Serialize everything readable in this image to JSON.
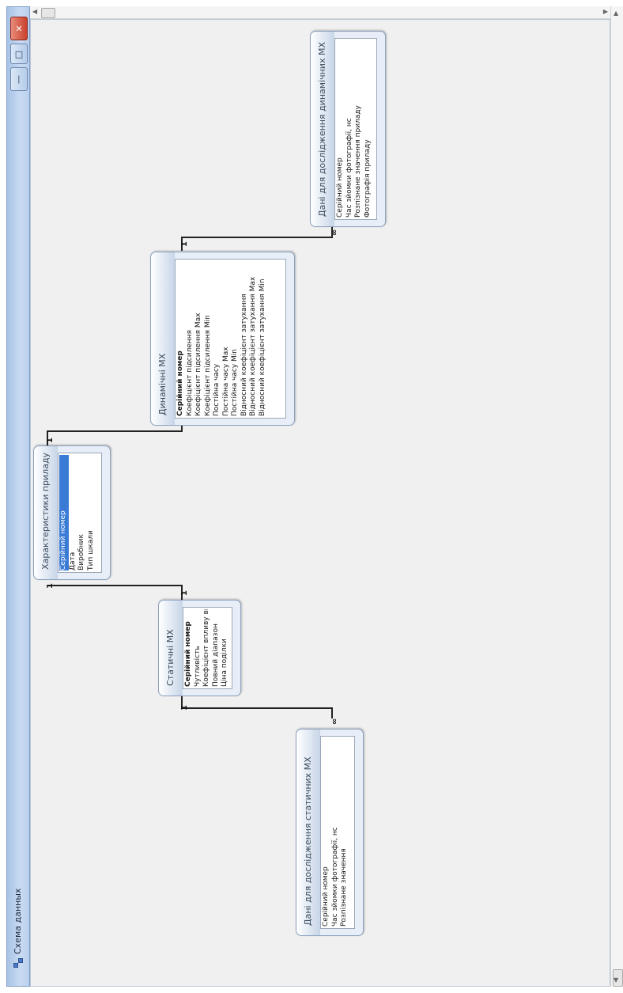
{
  "window": {
    "title": "Схема данных",
    "close_glyph": "✕",
    "max_glyph": "□",
    "min_glyph": "—"
  },
  "relation_labels": {
    "one": "1",
    "many": "∞"
  },
  "tables": {
    "characteristics": {
      "title": "Характеристики приладу",
      "fields": [
        "Серійний номер",
        "Дата",
        "Виробник",
        "Тип шкали"
      ]
    },
    "static": {
      "title": "Статичні МХ",
      "fields": [
        "Серійний номер",
        "Чутливість",
        "Коефіцієнт впливу вилівної вел",
        "Повний діапазон",
        "Ціна поділки"
      ]
    },
    "dynamic": {
      "title": "Динамічні МХ",
      "fields": [
        "Серійний номер",
        "Коефіцієнт підсилення",
        "Коефіцієнт підсилення Max",
        "Коефіцієнт підсилення Min",
        "Постійна часу",
        "Постійна часу Max",
        "Постійна часу Min",
        "Відносний коефіцієнт затухання",
        "Відносний коефіцієнт затухання Max",
        "Відносний коефіцієнт затухання Min"
      ]
    },
    "dynamic_data": {
      "title": "Дані для дослідження динамічних МХ",
      "fields": [
        "Серійний номер",
        "Час зйомки фотографії, нс",
        "Розпізнане значення приладу",
        "Фотографія приладу"
      ]
    },
    "static_data": {
      "title": "Дані для дослідження статичних МХ",
      "fields": [
        "Серійний номер",
        "Час зйомки фотографії, нс",
        "Розпізнане значення"
      ]
    }
  }
}
